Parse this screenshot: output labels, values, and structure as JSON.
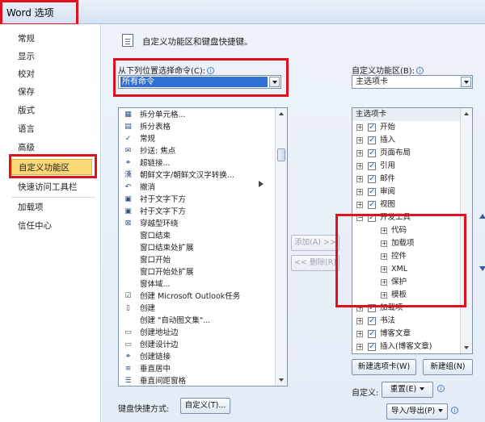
{
  "window": {
    "title": "Word 选项"
  },
  "nav": {
    "items": [
      "常规",
      "显示",
      "校对",
      "保存",
      "版式",
      "语言",
      "高级",
      "自定义功能区",
      "快速访问工具栏",
      "加载项",
      "信任中心"
    ],
    "selected_index": 7
  },
  "header": {
    "text": "自定义功能区和键盘快捷键。",
    "icon": "customize-ribbon-icon"
  },
  "left": {
    "choose_label": "从下列位置选择命令(C):",
    "choose_value": "所有命令",
    "commands": [
      {
        "label": "拆分单元格...",
        "icon": "split-cells-icon"
      },
      {
        "label": "拆分表格",
        "icon": "split-table-icon"
      },
      {
        "label": "常规",
        "icon": "checkmark-icon"
      },
      {
        "label": "抄送: 焦点",
        "icon": "cc-icon"
      },
      {
        "label": "超链接...",
        "icon": "hyperlink-icon"
      },
      {
        "label": "朝鲜文字/朝鲜文汉字转换...",
        "icon": "hangul-convert-icon"
      },
      {
        "label": "撤消",
        "icon": "undo-icon"
      },
      {
        "label": "衬于文字下方",
        "icon": "behind-text-icon"
      },
      {
        "label": "衬于文字下方",
        "icon": "behind-text-icon"
      },
      {
        "label": "穿越型环绕",
        "icon": "wrap-through-icon"
      },
      {
        "label": "窗口结束",
        "icon": ""
      },
      {
        "label": "窗口结束处扩展",
        "icon": ""
      },
      {
        "label": "窗口开始",
        "icon": ""
      },
      {
        "label": "窗口开始处扩展",
        "icon": ""
      },
      {
        "label": "窗体域...",
        "icon": ""
      },
      {
        "label": "创建 Microsoft Outlook任务",
        "icon": "outlook-task-icon"
      },
      {
        "label": "创建",
        "icon": "document-icon"
      },
      {
        "label": "创建 \"自动图文集\"...",
        "icon": ""
      },
      {
        "label": "创建地址边",
        "icon": "address-icon"
      },
      {
        "label": "创建设计边",
        "icon": "design-icon"
      },
      {
        "label": "创建链接",
        "icon": "link-icon"
      },
      {
        "label": "垂直居中",
        "icon": "align-middle-icon"
      },
      {
        "label": "垂直间距窗格",
        "icon": "spacing-icon"
      }
    ]
  },
  "middle": {
    "add_label": "添加(A) >>",
    "remove_label": "<< 删除(R)"
  },
  "right": {
    "ribbon_label": "自定义功能区(B):",
    "ribbon_value": "主选项卡",
    "tree_header": "主选项卡",
    "tree": [
      {
        "label": "开始",
        "level": 0,
        "checked": true,
        "expander": "+"
      },
      {
        "label": "插入",
        "level": 0,
        "checked": true,
        "expander": "+"
      },
      {
        "label": "页面布局",
        "level": 0,
        "checked": true,
        "expander": "+"
      },
      {
        "label": "引用",
        "level": 0,
        "checked": true,
        "expander": "+"
      },
      {
        "label": "邮件",
        "level": 0,
        "checked": true,
        "expander": "+"
      },
      {
        "label": "审阅",
        "level": 0,
        "checked": true,
        "expander": "+"
      },
      {
        "label": "视图",
        "level": 0,
        "checked": true,
        "expander": "+"
      },
      {
        "label": "开发工具",
        "level": 0,
        "checked": true,
        "expander": "−"
      },
      {
        "label": "代码",
        "level": 1,
        "checked": false,
        "expander": "+"
      },
      {
        "label": "加载项",
        "level": 1,
        "checked": false,
        "expander": "+"
      },
      {
        "label": "控件",
        "level": 1,
        "checked": false,
        "expander": "+"
      },
      {
        "label": "XML",
        "level": 1,
        "checked": false,
        "expander": "+"
      },
      {
        "label": "保护",
        "level": 1,
        "checked": false,
        "expander": "+"
      },
      {
        "label": "模板",
        "level": 1,
        "checked": false,
        "expander": "+"
      },
      {
        "label": "加载项",
        "level": 0,
        "checked": true,
        "expander": "+"
      },
      {
        "label": "书法",
        "level": 0,
        "checked": true,
        "expander": "+"
      },
      {
        "label": "博客文章",
        "level": 0,
        "checked": true,
        "expander": "+"
      },
      {
        "label": "插入(博客文章)",
        "level": 0,
        "checked": true,
        "expander": "+"
      }
    ],
    "new_tab_label": "新建选项卡(W)",
    "new_group_label": "新建组(N)",
    "customize_label": "自定义:",
    "reset_label": "重置(E)",
    "import_export_label": "导入/导出(P)"
  },
  "footer": {
    "shortcut_label": "键盘快捷方式:",
    "customize_button": "自定义(T)..."
  },
  "colors": {
    "highlight_box": "#e0101f",
    "selection": "#3370d4",
    "nav_selected": "#fbd876"
  }
}
